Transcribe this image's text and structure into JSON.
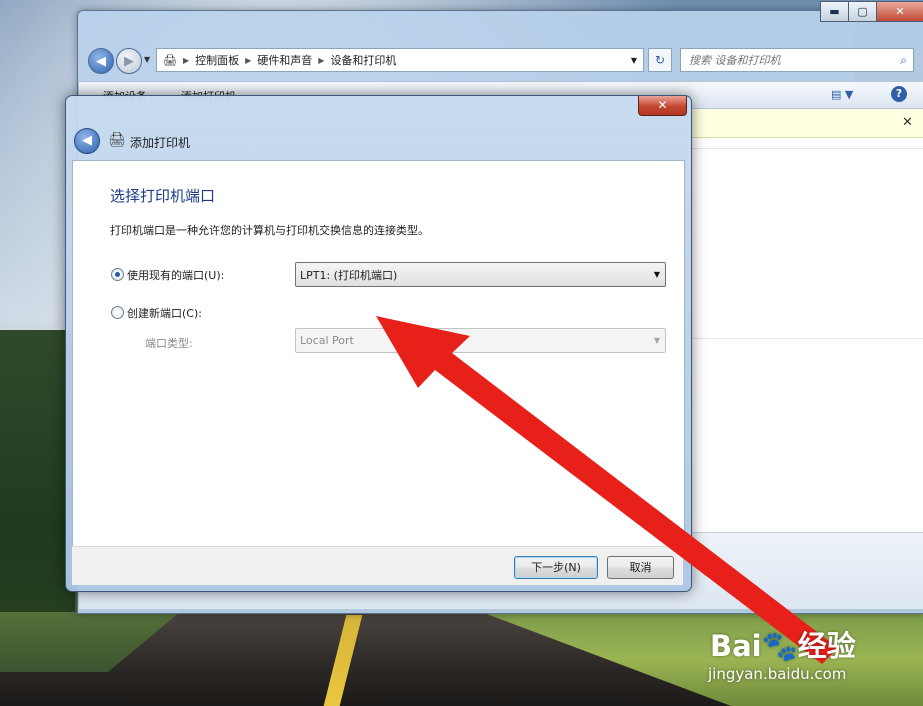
{
  "explorer": {
    "breadcrumbs": [
      "控制面板",
      "硬件和声音",
      "设备和打印机"
    ],
    "search_placeholder": "搜索 设备和打印机",
    "toolbar": {
      "add_device": "添加设备",
      "add_printer": "添加打印机"
    },
    "window_buttons": {
      "minimize": "▬",
      "maximize": "▢",
      "close": "✕"
    },
    "help": "?"
  },
  "dialog": {
    "title": "添加打印机",
    "close": "✕",
    "heading": "选择打印机端口",
    "description": "打印机端口是一种允许您的计算机与打印机交换信息的连接类型。",
    "use_existing_label": "使用现有的端口(U):",
    "use_existing_checked": true,
    "existing_port_value": "LPT1: (打印机端口)",
    "create_new_label": "创建新端口(C):",
    "create_new_checked": false,
    "port_type_label": "端口类型:",
    "port_type_value": "Local Port",
    "next_button": "下一步(N)",
    "cancel_button": "取消"
  },
  "watermark": {
    "brand": "Bai🐾经验",
    "url": "jingyan.baidu.com"
  },
  "colors": {
    "annotation_arrow": "#e8201a",
    "heading_blue": "#1e3c8c"
  }
}
